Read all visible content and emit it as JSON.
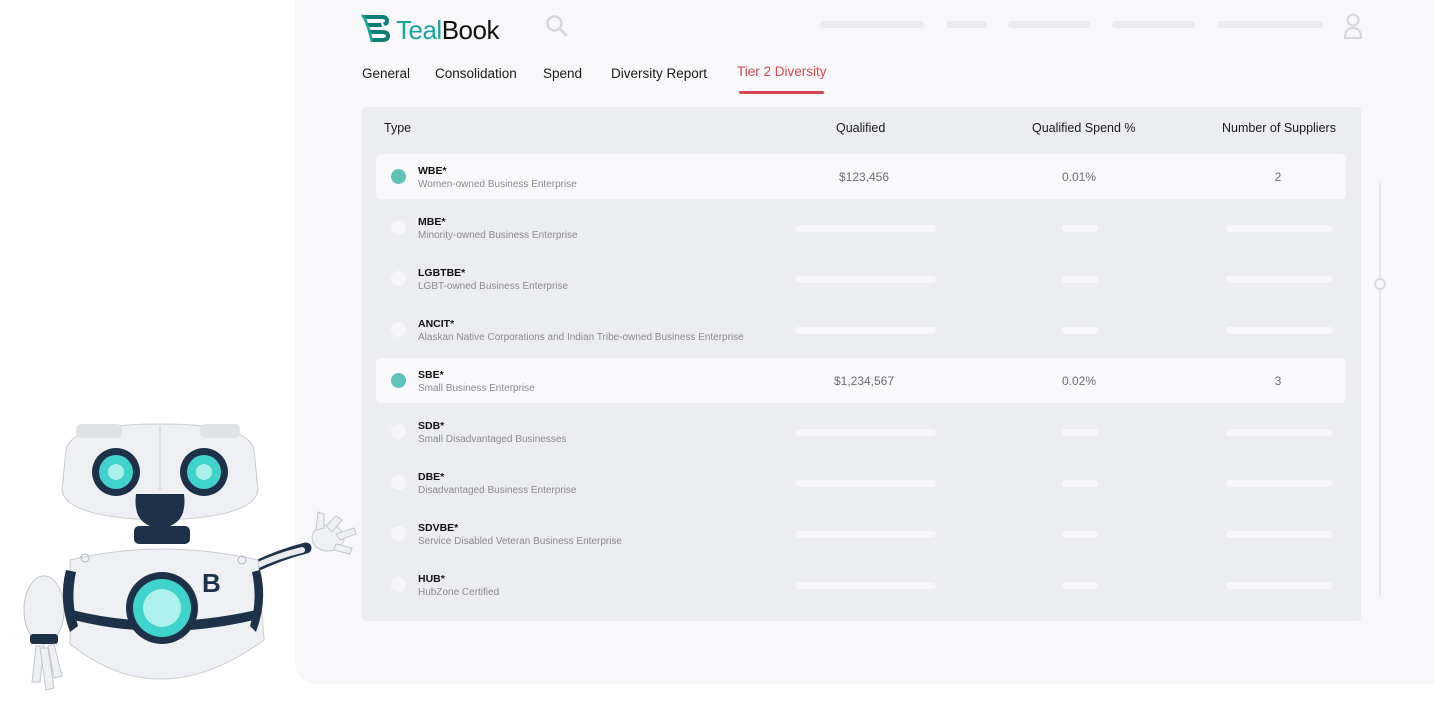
{
  "brand": {
    "name_prefix": "Teal",
    "name_suffix": "Book",
    "accent": "#1aa59a"
  },
  "icons": {
    "search": "search-icon",
    "user": "user-icon",
    "logo": "tealbook-logo-icon"
  },
  "tabs": [
    {
      "label": "General"
    },
    {
      "label": "Consolidation"
    },
    {
      "label": "Spend"
    },
    {
      "label": "Diversity Report"
    },
    {
      "label": "Tier 2 Diversity",
      "active": true
    }
  ],
  "table": {
    "headers": {
      "type": "Type",
      "qualified": "Qualified",
      "spend_pct": "Qualified Spend %",
      "suppliers": "Number of Suppliers"
    },
    "rows": [
      {
        "code": "WBE*",
        "desc": "Women-owned Business Enterprise",
        "selected": true,
        "qualified": "$123,456",
        "spend_pct": "0.01%",
        "suppliers": "2"
      },
      {
        "code": "MBE*",
        "desc": "Minority-owned Business Enterprise",
        "selected": false
      },
      {
        "code": "LGBTBE*",
        "desc": "LGBT-owned Business Enterprise",
        "selected": false
      },
      {
        "code": "ANCIT*",
        "desc": "Alaskan Native Corporations and Indian Tribe-owned Business Enterprise",
        "selected": false
      },
      {
        "code": "SBE*",
        "desc": "Small Business Enterprise",
        "selected": true,
        "qualified": "$1,234,567",
        "spend_pct": "0.02%",
        "suppliers": "3"
      },
      {
        "code": "SDB*",
        "desc": "Small Disadvantaged Businesses",
        "selected": false
      },
      {
        "code": "DBE*",
        "desc": "Disadvantaged Business Enterprise",
        "selected": false
      },
      {
        "code": "SDVBE*",
        "desc": "Service Disabled Veteran Business Enterprise",
        "selected": false
      },
      {
        "code": "HUB*",
        "desc": "HubZone Certified",
        "selected": false
      }
    ]
  },
  "colors": {
    "active_tab": "#d9464f",
    "selected_dot": "#5fc3b7"
  }
}
